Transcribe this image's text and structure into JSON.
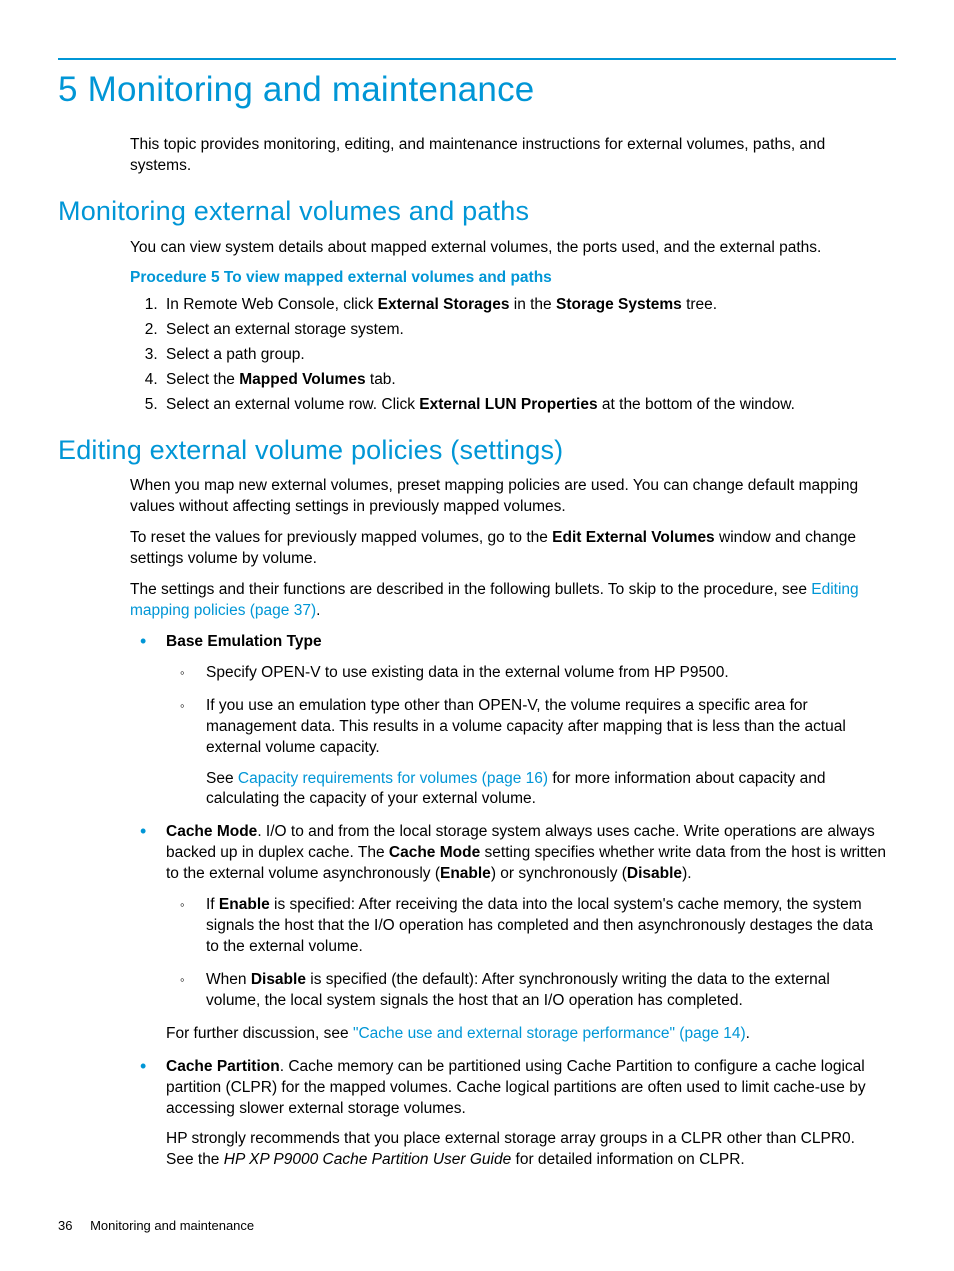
{
  "chapter_title": "5 Monitoring and maintenance",
  "intro": "This topic provides monitoring, editing, and maintenance instructions for external volumes, paths, and systems.",
  "s1": {
    "title": "Monitoring external volumes and paths",
    "p1": "You can view system details about mapped external volumes, the ports used, and the external paths.",
    "proc_title": "Procedure 5 To view mapped external volumes and paths",
    "steps": {
      "n1a": "In Remote Web Console, click ",
      "n1b": "External Storages",
      "n1c": " in the ",
      "n1d": "Storage Systems",
      "n1e": " tree.",
      "n2": "Select an external storage system.",
      "n3": "Select a path group.",
      "n4a": "Select the ",
      "n4b": "Mapped Volumes",
      "n4c": " tab.",
      "n5a": "Select an external volume row. Click ",
      "n5b": "External LUN Properties",
      "n5c": " at the bottom of the window."
    }
  },
  "s2": {
    "title": "Editing external volume policies (settings)",
    "p1": "When you map new external volumes, preset mapping policies are used. You can change default mapping values without affecting settings in previously mapped volumes.",
    "p2a": "To reset the values for previously mapped volumes, go to the ",
    "p2b": "Edit External Volumes",
    "p2c": "  window and change settings volume by volume.",
    "p3a": "The settings and their functions are described in the following bullets. To skip to the procedure, see ",
    "p3link": "Editing mapping policies (page 37)",
    "p3b": ".",
    "b1": {
      "title": "Base Emulation Type",
      "s1": "Specify OPEN-V to use existing data in the external volume from HP P9500.",
      "s2": "If you use an emulation type other than OPEN-V, the volume requires a specific area for management data. This results in a volume capacity after mapping that is less than the actual external volume capacity.",
      "s2p_a": "See ",
      "s2p_link": "Capacity requirements for volumes (page 16)",
      "s2p_b": " for more information about capacity and calculating the capacity of your external volume."
    },
    "b2": {
      "title": "Cache Mode",
      "intro_a": ". I/O to and from the local storage system always uses cache. Write operations are always backed up in duplex cache. The ",
      "intro_b": "Cache Mode",
      "intro_c": " setting specifies whether write data from the host is written to the external volume asynchronously (",
      "intro_d": "Enable",
      "intro_e": ") or synchronously (",
      "intro_f": "Disable",
      "intro_g": ").",
      "s1a": "If ",
      "s1b": "Enable",
      "s1c": " is specified: After receiving the data into the local system's cache memory, the system signals the host that the I/O operation has completed and then asynchronously destages the data to the external volume.",
      "s2a": "When ",
      "s2b": "Disable",
      "s2c": " is specified (the default): After synchronously writing the data to the external volume, the local system signals the host that an I/O operation has completed.",
      "tail_a": "For further discussion, see ",
      "tail_link": "\"Cache use and external storage performance\" (page 14)",
      "tail_b": "."
    },
    "b3": {
      "title": "Cache Partition",
      "intro": ". Cache memory can be partitioned using Cache Partition to configure a cache logical partition (CLPR) for the mapped volumes. Cache logical partitions are often used to limit cache-use by accessing slower external storage volumes.",
      "p2a": "HP strongly recommends that you place external storage array groups in a CLPR other than CLPR0. See the ",
      "p2i": "HP XP P9000 Cache Partition User Guide",
      "p2b": " for detailed information on CLPR."
    }
  },
  "footer": {
    "page": "36",
    "title": "Monitoring and maintenance"
  }
}
